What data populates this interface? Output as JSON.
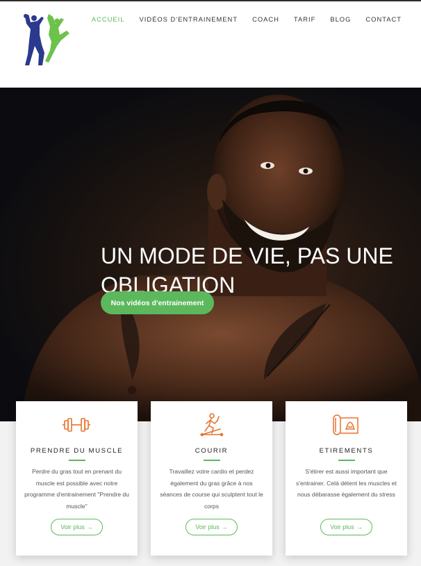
{
  "colors": {
    "accent": "#5cb85c",
    "icon": "#e8722c",
    "nav_text": "#333333"
  },
  "nav": {
    "items": [
      {
        "label": "ACCUEIL",
        "active": true
      },
      {
        "label": "VIDÉOS D'ENTRAINEMENT",
        "active": false
      },
      {
        "label": "COACH",
        "active": false
      },
      {
        "label": "TARIF",
        "active": false
      },
      {
        "label": "BLOG",
        "active": false
      },
      {
        "label": "CONTACT",
        "active": false
      }
    ]
  },
  "hero": {
    "title": "UN MODE DE VIE, PAS UNE OBLIGATION",
    "button_label": "Nos vidéos d'entrainement"
  },
  "cards": [
    {
      "icon": "dumbbell-icon",
      "title": "PRENDRE DU MUSCLE",
      "text": "Perdre du gras tout en prenant du muscle est possible avec notre programme d'entrainement \"Prendre du muscle\"",
      "button_label": "Voir plus"
    },
    {
      "icon": "treadmill-icon",
      "title": "COURIR",
      "text": "Travaillez votre cardio et perdez également du gras grâce à nos séances de course qui sculptent tout le corps",
      "button_label": "Voir plus"
    },
    {
      "icon": "yoga-mat-icon",
      "title": "ETIREMENTS",
      "text": "S'étirer est aussi important que s'entrainer. Celà détent les muscles et nous débarasse également du stress",
      "button_label": "Voir plus"
    }
  ]
}
